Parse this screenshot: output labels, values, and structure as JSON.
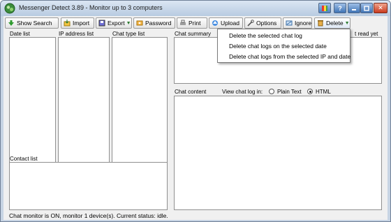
{
  "window": {
    "title": "Messenger Detect 3.89 - Monitor up to 3 computers",
    "controls": {
      "help": "?",
      "close": "✕"
    }
  },
  "toolbar": {
    "show_search": "Show Search",
    "import": "Import",
    "export": "Export",
    "password": "Password",
    "print": "Print",
    "upload": "Upload",
    "options": "Options",
    "ignore": "Ignore",
    "delete": "Delete"
  },
  "panels": {
    "date_list": "Date list",
    "ip_list": "IP address list",
    "chat_type_list": "Chat type list",
    "contact_list": "Contact list",
    "chat_summary": "Chat summary",
    "summary_fragment": "t read yet",
    "chat_content": "Chat content",
    "view_log_in": "View chat log in:",
    "plain_text": "Plain Text",
    "html": "HTML",
    "selected_view": "HTML"
  },
  "delete_menu": {
    "items": [
      "Delete the selected chat log",
      "Delete chat logs on the selected date",
      "Delete chat logs from the selected IP and date"
    ]
  },
  "status": "Chat monitor is ON, monitor 1 device(s). Current status: idle."
}
